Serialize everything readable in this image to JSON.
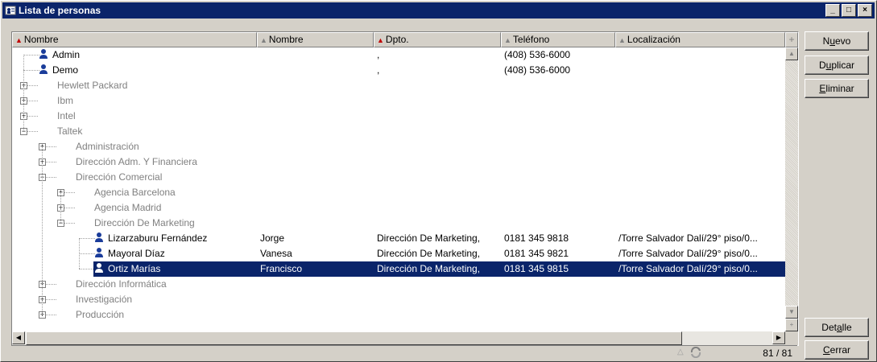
{
  "window": {
    "title": "Lista de personas"
  },
  "columns": [
    {
      "label": "Nombre",
      "sorted": true
    },
    {
      "label": "Nombre",
      "sorted": false
    },
    {
      "label": "Dpto.",
      "sorted": true
    },
    {
      "label": "Teléfono",
      "sorted": false
    },
    {
      "label": "Localización",
      "sorted": false
    }
  ],
  "rows": [
    {
      "type": "person",
      "level": 0,
      "name": "Admin",
      "first": "",
      "dept": ",",
      "phone": "(408) 536-6000",
      "loc": ""
    },
    {
      "type": "person",
      "level": 0,
      "name": "Demo",
      "first": "",
      "dept": ",",
      "phone": "(408) 536-6000",
      "loc": ""
    },
    {
      "type": "group",
      "level": 0,
      "name": "Hewlett Packard",
      "expanded": false
    },
    {
      "type": "group",
      "level": 0,
      "name": "Ibm",
      "expanded": false
    },
    {
      "type": "group",
      "level": 0,
      "name": "Intel",
      "expanded": false
    },
    {
      "type": "group",
      "level": 0,
      "name": "Taltek",
      "expanded": true
    },
    {
      "type": "group",
      "level": 1,
      "name": "Administración",
      "expanded": false
    },
    {
      "type": "group",
      "level": 1,
      "name": "Dirección Adm. Y Financiera",
      "expanded": false
    },
    {
      "type": "group",
      "level": 1,
      "name": "Dirección Comercial",
      "expanded": true
    },
    {
      "type": "group",
      "level": 2,
      "name": "Agencia Barcelona",
      "expanded": false
    },
    {
      "type": "group",
      "level": 2,
      "name": "Agencia Madrid",
      "expanded": false
    },
    {
      "type": "group",
      "level": 2,
      "name": "Dirección De Marketing",
      "expanded": true
    },
    {
      "type": "person",
      "level": 3,
      "name": "Lizarzaburu Fernández",
      "first": "Jorge",
      "dept": "Dirección De Marketing,",
      "phone": "0181 345 9818",
      "loc": "/Torre Salvador Dalí/29° piso/0..."
    },
    {
      "type": "person",
      "level": 3,
      "name": "Mayoral Díaz",
      "first": "Vanesa",
      "dept": "Dirección De Marketing,",
      "phone": "0181 345 9821",
      "loc": "/Torre Salvador Dalí/29° piso/0..."
    },
    {
      "type": "person",
      "level": 3,
      "name": "Ortiz Marías",
      "first": "Francisco",
      "dept": "Dirección De Marketing,",
      "phone": "0181 345 9815",
      "loc": "/Torre Salvador Dalí/29° piso/0...",
      "selected": true
    },
    {
      "type": "group",
      "level": 1,
      "name": "Dirección Informática",
      "expanded": false
    },
    {
      "type": "group",
      "level": 1,
      "name": "Investigación",
      "expanded": false
    },
    {
      "type": "group",
      "level": 1,
      "name": "Producción",
      "expanded": false
    }
  ],
  "status": {
    "count": "81 / 81"
  },
  "buttons": {
    "new": {
      "pre": "N",
      "u": "u",
      "post": "evo"
    },
    "duplicate": {
      "pre": "D",
      "u": "u",
      "post": "plicar"
    },
    "delete": {
      "pre": "",
      "u": "E",
      "post": "liminar"
    },
    "detail": {
      "pre": "Det",
      "u": "a",
      "post": "lle"
    },
    "close": {
      "pre": "",
      "u": "C",
      "post": "errar"
    }
  },
  "colors": {
    "titlebar": "#0a246a",
    "selection": "#0a246a",
    "face": "#d4d0c8"
  }
}
